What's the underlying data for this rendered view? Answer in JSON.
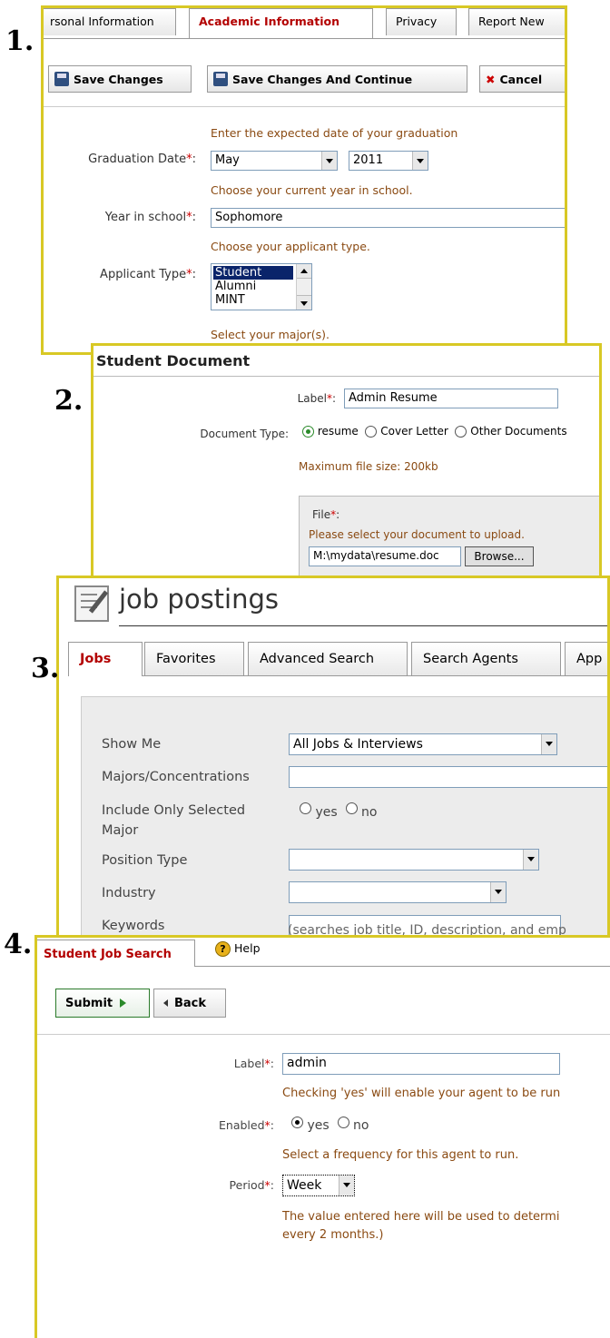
{
  "steps": [
    "1.",
    "2.",
    "3.",
    "4."
  ],
  "panel1": {
    "tabs": [
      "rsonal Information",
      "Academic Information",
      "Privacy",
      "Report New"
    ],
    "active_tab": 1,
    "buttons": {
      "save": "Save Changes",
      "save_continue": "Save Changes And Continue",
      "cancel": "Cancel"
    },
    "graduation": {
      "hint": "Enter the expected date of your graduation",
      "label": "Graduation Date",
      "month": "May",
      "year": "2011"
    },
    "year_in_school": {
      "hint": "Choose your current year in school.",
      "label": "Year in school",
      "value": "Sophomore"
    },
    "applicant_type": {
      "hint": "Choose your applicant type.",
      "label": "Applicant Type",
      "options": [
        "Student",
        "Alumni",
        "MINT"
      ],
      "selected": 0
    },
    "major_hint": "Select your major(s)."
  },
  "panel2": {
    "title": "Student Document",
    "label": {
      "label": "Label",
      "value": "Admin Resume"
    },
    "doc_type": {
      "label": "Document Type:",
      "options": [
        "resume",
        "Cover Letter",
        "Other Documents"
      ],
      "selected": 0
    },
    "max_size": "Maximum file size: 200kb",
    "file": {
      "label": "File",
      "hint": "Please select your document to upload.",
      "value": "M:\\mydata\\resume.doc",
      "browse": "Browse..."
    }
  },
  "panel3": {
    "title": "job postings",
    "tabs": [
      "Jobs",
      "Favorites",
      "Advanced Search",
      "Search Agents",
      "App"
    ],
    "show_me": {
      "label": "Show Me",
      "value": "All Jobs & Interviews"
    },
    "majors": {
      "label": "Majors/Concentrations",
      "value": ""
    },
    "include_major": {
      "label_line1": "Include Only Selected",
      "label_line2": "Major",
      "yes": "yes",
      "no": "no"
    },
    "position_type": {
      "label": "Position Type",
      "value": ""
    },
    "industry": {
      "label": "Industry",
      "value": ""
    },
    "keywords": {
      "label": "Keywords",
      "value": "",
      "hint": "(searches job title, ID, description, and emp"
    }
  },
  "panel4": {
    "tabs": {
      "active": "Student Job Search",
      "help": "Help"
    },
    "buttons": {
      "submit": "Submit",
      "back": "Back"
    },
    "label": {
      "label": "Label",
      "value": "admin"
    },
    "enabled_hint": "Checking 'yes' will enable your agent to be run",
    "enabled": {
      "label": "Enabled",
      "yes": "yes",
      "no": "no"
    },
    "frequency_hint": "Select a frequency for this agent to run.",
    "period": {
      "label": "Period",
      "value": "Week"
    },
    "period_hint_line1": "The value entered here will be used to determi",
    "period_hint_line2": "every 2 months.)"
  },
  "colors": {
    "panel_border": "#d8c825",
    "hint_text": "#8a4a12",
    "required": "#cc0000",
    "tab_active": "#b30000",
    "grey_bg": "#ececec"
  }
}
